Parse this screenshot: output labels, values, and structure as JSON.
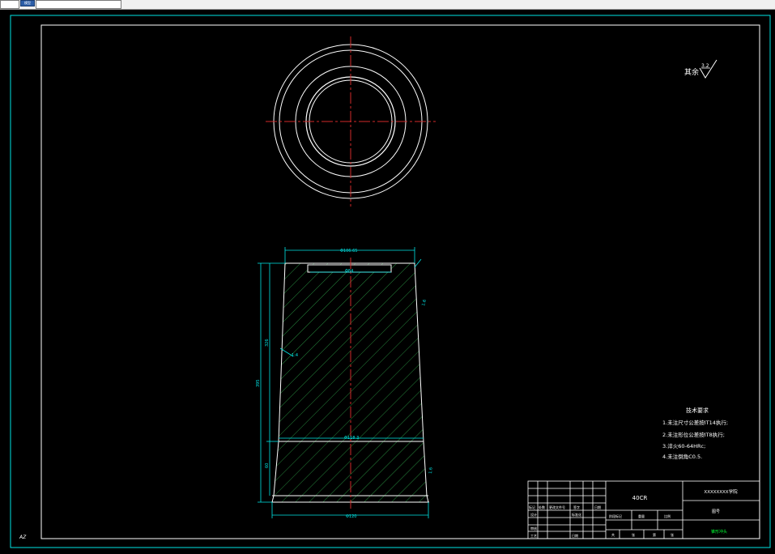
{
  "app": {
    "tab_label": "模型"
  },
  "drawing": {
    "roughness_label": "其余",
    "roughness_value": "3.2",
    "dims": {
      "top_dia": "Φ106.65",
      "bore_dia": "Φ84",
      "bottom_dia": "Φ120",
      "mid_dia": "Φ118.3",
      "height_total": "395",
      "height_mid": "326",
      "height_low": "60",
      "taper_note": "1:4",
      "rough_right_1": "1.6",
      "rough_right_2": "1.6"
    },
    "tech_req": {
      "title": "技术要求",
      "items": [
        "1.未注尺寸公差按IT14执行;",
        "2.未注形位公差按IT8执行;",
        "3.淬火60-64HRc;",
        "4.未注倒角C0.5."
      ]
    },
    "title_block": {
      "material": "40CR",
      "school": "XXXXXXXX学院",
      "part_name": "锥形冲头",
      "drawing_no": "图号",
      "left_cells": [
        "标记",
        "处数",
        "更改文件号",
        "签字",
        "日期"
      ],
      "row2": [
        "设计",
        "",
        "标准化"
      ],
      "row3": [
        "审核",
        ""
      ],
      "row4": [
        "工艺",
        "",
        "日期"
      ],
      "mid_cells": [
        "阶段标记",
        "重量",
        "比例"
      ],
      "sheet": [
        "共",
        "张",
        "第",
        "张"
      ]
    },
    "axis_tag": "AZ"
  },
  "colors": {
    "border": "#00e5e5",
    "outline": "#ffffff",
    "hatch": "#2ea84a",
    "center": "#d22a2a",
    "dim": "#00e5e5"
  }
}
